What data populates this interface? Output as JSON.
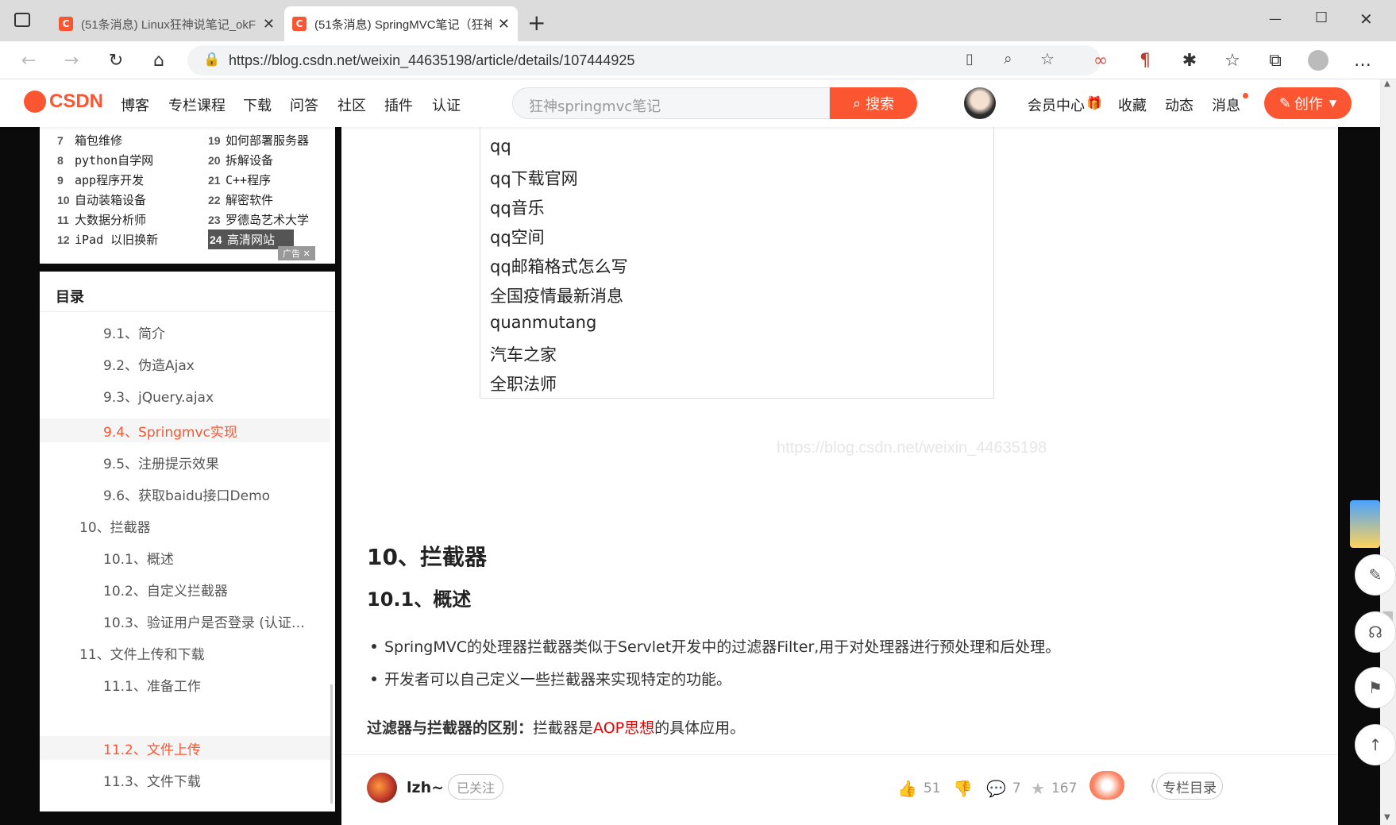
{
  "browser": {
    "tabs": [
      {
        "title": "(51条消息) Linux狂神说笔记_okF",
        "active": false
      },
      {
        "title": "(51条消息) SpringMVC笔记（狂神",
        "active": true
      }
    ],
    "new_tab": "+",
    "url": "https://blog.csdn.net/weixin_44635198/article/details/107444925",
    "window_controls": {
      "minimize": "—",
      "maximize": "☐",
      "close": "✕"
    }
  },
  "csdn": {
    "logo": "CSDN",
    "nav": [
      "博客",
      "专栏课程",
      "下载",
      "问答",
      "社区",
      "插件",
      "认证"
    ],
    "search_placeholder": "狂神springmvc笔记",
    "search_button": "搜索",
    "right_links": [
      "会员中心",
      "收藏",
      "动态",
      "消息"
    ],
    "create_button": "创作",
    "accent_color": "#fc5531"
  },
  "hot_list": [
    {
      "n": "7",
      "t": "箱包维修"
    },
    {
      "n": "19",
      "t": "如何部署服务器"
    },
    {
      "n": "8",
      "t": "python自学网"
    },
    {
      "n": "20",
      "t": "拆解设备"
    },
    {
      "n": "9",
      "t": "app程序开发"
    },
    {
      "n": "21",
      "t": "C++程序"
    },
    {
      "n": "10",
      "t": "自动装箱设备"
    },
    {
      "n": "22",
      "t": "解密软件"
    },
    {
      "n": "11",
      "t": "大数据分析师"
    },
    {
      "n": "23",
      "t": "罗德岛艺术大学"
    },
    {
      "n": "12",
      "t": "iPad 以旧换新"
    },
    {
      "n": "24",
      "t": "高清网站"
    }
  ],
  "ad_label": "广告",
  "toc": {
    "title": "目录",
    "items": [
      {
        "t": "9.1、简介",
        "level": 2
      },
      {
        "t": "9.2、伪造Ajax",
        "level": 2
      },
      {
        "t": "9.3、jQuery.ajax",
        "level": 2
      },
      {
        "t": "9.4、Springmvc实现",
        "level": 2,
        "active": true
      },
      {
        "t": "9.5、注册提示效果",
        "level": 2
      },
      {
        "t": "9.6、获取baidu接口Demo",
        "level": 2
      },
      {
        "t": "10、拦截器",
        "level": 1
      },
      {
        "t": "10.1、概述",
        "level": 2
      },
      {
        "t": "10.2、自定义拦截器",
        "level": 2
      },
      {
        "t": "10.3、验证用户是否登录 (认证…",
        "level": 2
      },
      {
        "t": "11、文件上传和下载",
        "level": 1
      },
      {
        "t": "11.1、准备工作",
        "level": 2
      },
      {
        "t": "11.2、文件上传",
        "level": 2,
        "active": true
      },
      {
        "t": "11.3、文件下载",
        "level": 2
      }
    ]
  },
  "suggestions": [
    "qq",
    "qq下载官网",
    "qq音乐",
    "qq空间",
    "qq邮箱格式怎么写",
    "全国疫情最新消息",
    "quanmutang",
    "汽车之家",
    "全职法师"
  ],
  "watermark": "https://blog.csdn.net/weixin_44635198",
  "article": {
    "h1": "10、拦截器",
    "h2": "10.1、概述",
    "bullets": [
      "SpringMVC的处理器拦截器类似于Servlet开发中的过滤器Filter,用于对处理器进行预处理和后处理。",
      "开发者可以自己定义一些拦截器来实现特定的功能。"
    ],
    "para_bold": "过滤器与拦截器的区别：",
    "para_a": "拦截器是",
    "para_red": "AOP思想",
    "para_b": "的具体应用。"
  },
  "author_bar": {
    "name": "lzh~",
    "follow": "已关注",
    "likes": "51",
    "comments": "7",
    "favorites": "167",
    "catalog": "专栏目录"
  }
}
